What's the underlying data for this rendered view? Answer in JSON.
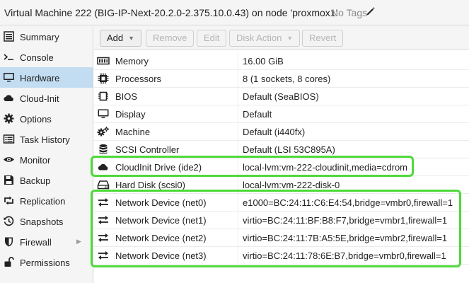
{
  "window": {
    "title": "Virtual Machine 222 (BIG-IP-Next-20.2.0-2.375.10.0.43) on node 'proxmox1'",
    "tags_label": "No Tags"
  },
  "sidebar": {
    "items": [
      {
        "label": "Summary",
        "icon": "summary-icon"
      },
      {
        "label": "Console",
        "icon": "console-icon"
      },
      {
        "label": "Hardware",
        "icon": "monitor-icon",
        "active": true
      },
      {
        "label": "Cloud-Init",
        "icon": "cloud-icon"
      },
      {
        "label": "Options",
        "icon": "gear-icon"
      },
      {
        "label": "Task History",
        "icon": "list-icon"
      },
      {
        "label": "Monitor",
        "icon": "eye-icon"
      },
      {
        "label": "Backup",
        "icon": "floppy-icon"
      },
      {
        "label": "Replication",
        "icon": "retweet-icon"
      },
      {
        "label": "Snapshots",
        "icon": "history-icon"
      },
      {
        "label": "Firewall",
        "icon": "shield-icon",
        "expandable": true
      },
      {
        "label": "Permissions",
        "icon": "unlock-icon"
      }
    ]
  },
  "toolbar": {
    "add_label": "Add",
    "remove_label": "Remove",
    "edit_label": "Edit",
    "disk_action_label": "Disk Action",
    "revert_label": "Revert"
  },
  "hardware": {
    "rows": [
      {
        "name": "Memory",
        "value": "16.00 GiB",
        "icon": "memory-icon"
      },
      {
        "name": "Processors",
        "value": "8 (1 sockets, 8 cores)",
        "icon": "cpu-icon"
      },
      {
        "name": "BIOS",
        "value": "Default (SeaBIOS)",
        "icon": "chip-icon"
      },
      {
        "name": "Display",
        "value": "Default",
        "icon": "display-icon"
      },
      {
        "name": "Machine",
        "value": "Default (i440fx)",
        "icon": "cogs-icon"
      },
      {
        "name": "SCSI Controller",
        "value": "Default (LSI 53C895A)",
        "icon": "database-icon"
      },
      {
        "name": "CloudInit Drive (ide2)",
        "value": "local-lvm:vm-222-cloudinit,media=cdrom",
        "icon": "cloud-icon"
      },
      {
        "name": "Hard Disk (scsi0)",
        "value": "local-lvm:vm-222-disk-0",
        "icon": "hdd-icon"
      },
      {
        "name": "Network Device (net0)",
        "value": "e1000=BC:24:11:C6:E4:54,bridge=vmbr0,firewall=1",
        "icon": "exchange-icon"
      },
      {
        "name": "Network Device (net1)",
        "value": "virtio=BC:24:11:BF:B8:F7,bridge=vmbr1,firewall=1",
        "icon": "exchange-icon"
      },
      {
        "name": "Network Device (net2)",
        "value": "virtio=BC:24:11:7B:A5:5E,bridge=vmbr2,firewall=1",
        "icon": "exchange-icon"
      },
      {
        "name": "Network Device (net3)",
        "value": "virtio=BC:24:11:78:6E:B7,bridge=vmbr0,firewall=1",
        "icon": "exchange-icon"
      }
    ]
  },
  "colors": {
    "highlight": "#4fd93a",
    "active_nav": "#c2ddf2"
  }
}
